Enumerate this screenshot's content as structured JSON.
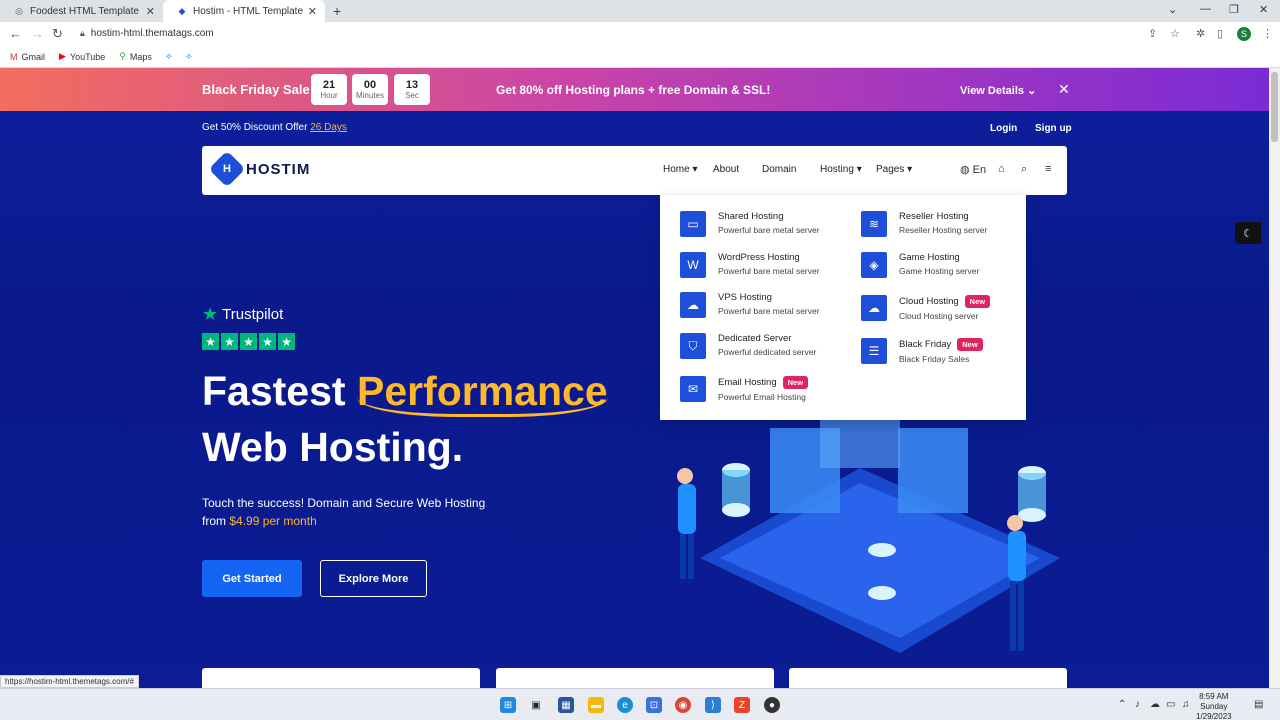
{
  "browser": {
    "tabs": [
      {
        "title": "Foodest HTML Template",
        "active": false
      },
      {
        "title": "Hostim - HTML Template",
        "active": true
      }
    ],
    "url": "hostim-html.thematags.com",
    "bookmarks": [
      "Gmail",
      "YouTube",
      "Maps"
    ],
    "status_url": "https://hostim-html.themetags.com/#"
  },
  "promo": {
    "title": "Black Friday Sale",
    "countdown": [
      {
        "value": "21",
        "unit": "Hour"
      },
      {
        "value": "00",
        "unit": "Minutes"
      },
      {
        "value": "13",
        "unit": "Sec"
      }
    ],
    "offer": "Get 80% off Hosting plans + free Domain & SSL!",
    "view_details": "View Details",
    "close": "✕"
  },
  "topbar": {
    "offer_text": "Get 50% Discount Offer",
    "offer_days": "26 Days",
    "login": "Login",
    "signup": "Sign up"
  },
  "nav": {
    "logo": "HOSTIM",
    "links": [
      "Home",
      "About",
      "Domain",
      "Hosting",
      "Pages"
    ],
    "lang": "En"
  },
  "mega_menu": {
    "left": [
      {
        "title": "Shared Hosting",
        "sub": "Powerful bare metal server",
        "badge": ""
      },
      {
        "title": "WordPress Hosting",
        "sub": "Powerful bare metal server",
        "badge": ""
      },
      {
        "title": "VPS Hosting",
        "sub": "Powerful bare metal server",
        "badge": ""
      },
      {
        "title": "Dedicated Server",
        "sub": "Powerful dedicated server",
        "badge": ""
      },
      {
        "title": "Email Hosting",
        "sub": "Powerful Email Hosting",
        "badge": "New"
      }
    ],
    "right": [
      {
        "title": "Reseller Hosting",
        "sub": "Reseller Hosting server",
        "badge": ""
      },
      {
        "title": "Game Hosting",
        "sub": "Game Hosting server",
        "badge": ""
      },
      {
        "title": "Cloud Hosting",
        "sub": "Cloud Hosting server",
        "badge": "New"
      },
      {
        "title": "Black Friday",
        "sub": "Black Friday Sales",
        "badge": "New"
      }
    ]
  },
  "hero": {
    "trustpilot": "Trustpilot",
    "headline_a": "Fastest",
    "headline_highlight": "Performance",
    "headline_b": "Web Hosting.",
    "sub_line1": "Touch the success! Domain and Secure Web Hosting",
    "sub_from": "from",
    "sub_price": "$4.99 per month",
    "cta_primary": "Get Started",
    "cta_secondary": "Explore More"
  },
  "taskbar": {
    "time": "8:59 AM",
    "day": "Sunday",
    "date": "1/29/2023"
  }
}
